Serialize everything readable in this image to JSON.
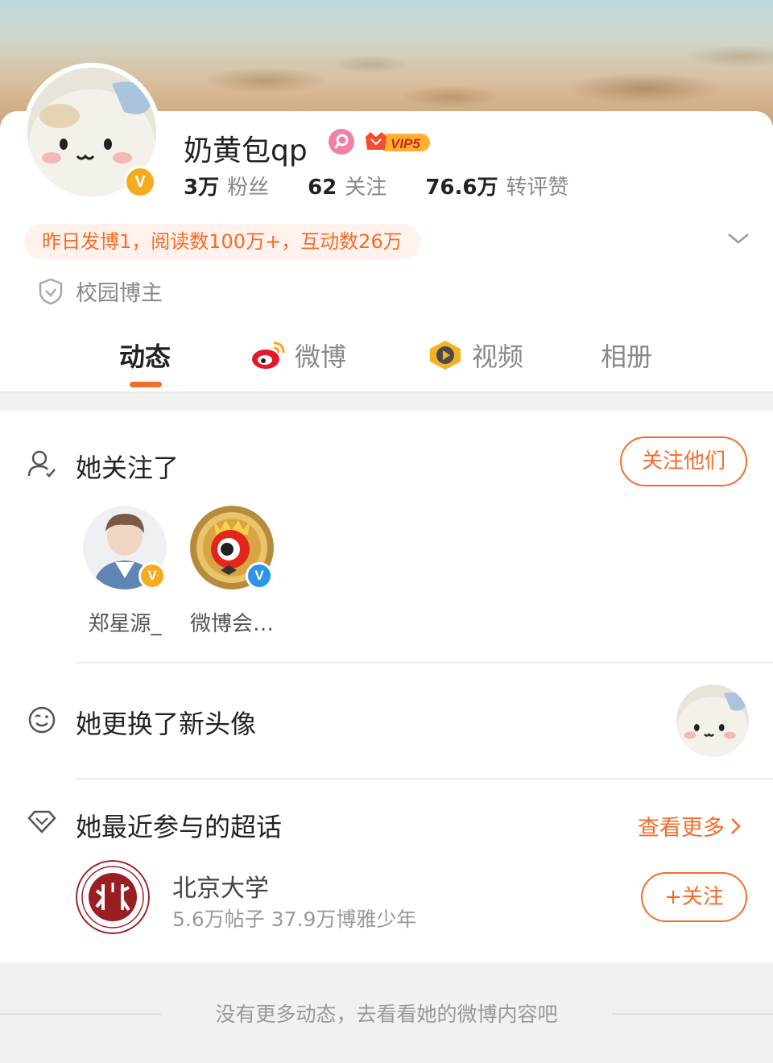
{
  "profile": {
    "username": "奶黄包qp",
    "vip_label": "VIP5",
    "stats": [
      {
        "num": "3万",
        "label": "粉丝"
      },
      {
        "num": "62",
        "label": "关注"
      },
      {
        "num": "76.6万",
        "label": "转评赞"
      }
    ],
    "activity_summary": "昨日发博1，阅读数100万+，互动数26万",
    "tag": "校园博主"
  },
  "tabs": [
    {
      "label": "动态",
      "active": true
    },
    {
      "label": "微博",
      "icon": "weibo-icon"
    },
    {
      "label": "视频",
      "icon": "video-icon"
    },
    {
      "label": "相册"
    }
  ],
  "following_section": {
    "title": "她关注了",
    "follow_button": "关注他们",
    "users": [
      {
        "name": "郑星源_",
        "badge": "gold-v"
      },
      {
        "name": "微博会…",
        "badge": "blue-v"
      }
    ]
  },
  "avatar_section": {
    "title": "她更换了新头像"
  },
  "super_topic_section": {
    "title": "她最近参与的超话",
    "see_more": "查看更多",
    "topic": {
      "name": "北京大学",
      "meta": "5.6万帖子 37.9万博雅少年",
      "follow_button": "+关注"
    }
  },
  "footer": {
    "text": "没有更多动态，去看看她的微博内容吧"
  },
  "colors": {
    "accent": "#f46c2a",
    "gold_v": "#f6ab1f",
    "blue_v": "#2d94e8",
    "pku_red": "#9b1e23"
  }
}
